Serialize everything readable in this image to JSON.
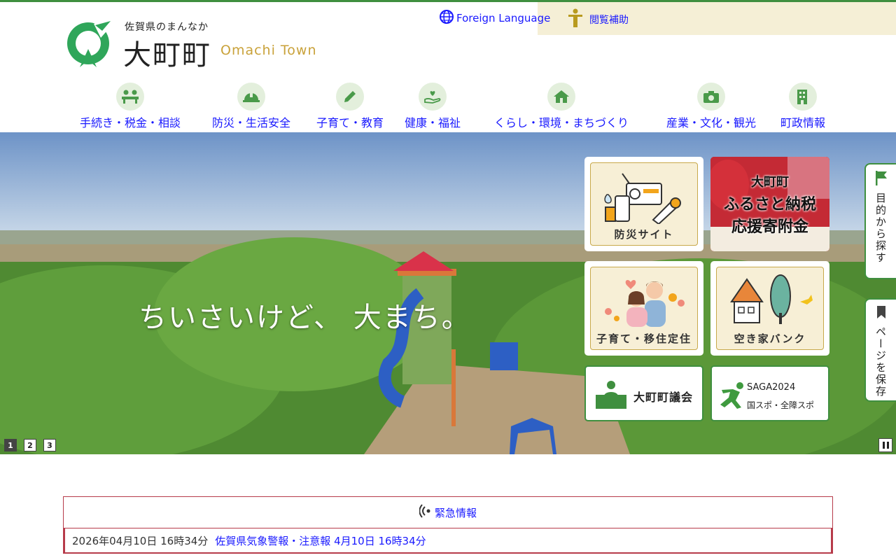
{
  "header": {
    "tagline": "佐賀県のまんなか",
    "town_name": "大町町",
    "town_name_en": "Omachi Town",
    "foreign_language": "Foreign Language",
    "accessibility": "閲覧補助"
  },
  "nav": [
    {
      "label": "手続き・税金・相談",
      "icon": "people-counter-icon"
    },
    {
      "label": "防災・生活安全",
      "icon": "helmet-icon"
    },
    {
      "label": "子育て・教育",
      "icon": "pencil-icon"
    },
    {
      "label": "健康・福祉",
      "icon": "heart-hand-icon"
    },
    {
      "label": "くらし・環境・まちづくり",
      "icon": "house-icon"
    },
    {
      "label": "産業・文化・観光",
      "icon": "camera-icon"
    },
    {
      "label": "町政情報",
      "icon": "building-icon"
    }
  ],
  "hero": {
    "catchphrase": "ちいさいけど、 大まち。",
    "slides": [
      "1",
      "2",
      "3"
    ],
    "active_slide": 1
  },
  "tiles": {
    "bousai": "防災サイト",
    "furusato_line1": "大町町",
    "furusato_line2": "ふるさと納税",
    "furusato_line3": "応援寄附金",
    "kosodate": "子育て・移住定住",
    "akiya": "空き家バンク",
    "gikai": "大町町議会",
    "saga_line1": "SAGA2024",
    "saga_line2": "国スポ・全障スポ"
  },
  "side_tabs": {
    "purpose": "目的から探す",
    "save": "ページを保存"
  },
  "emergency": {
    "title": "緊急情報",
    "date": "2026年04月10日 16時34分",
    "link": "佐賀県気象警報・注意報 4月10日 16時34分"
  },
  "colors": {
    "brand_green": "#3f8f3f",
    "link_blue": "#1a1aff",
    "gold": "#c9a23a",
    "alert_red": "#b73b4a"
  }
}
